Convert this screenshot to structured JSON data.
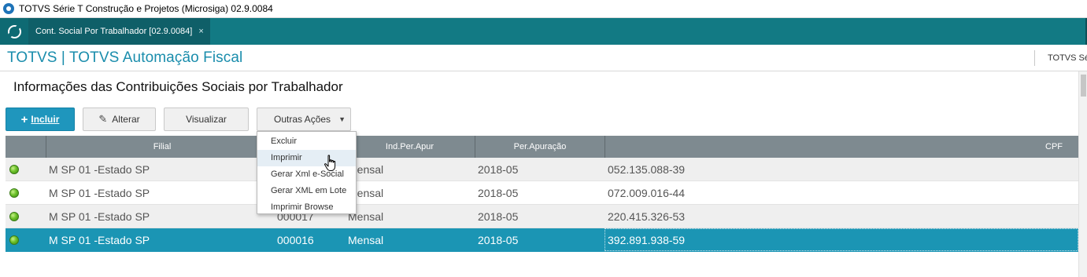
{
  "window": {
    "title": "TOTVS Série T Construção e Projetos (Microsiga) 02.9.0084"
  },
  "tabs": [
    {
      "label": "Cont. Social Por Trabalhador [02.9.0084]",
      "close": "×"
    }
  ],
  "module": {
    "name": "TOTVS | TOTVS Automação Fiscal",
    "right_info": "TOTVS Sé"
  },
  "page": {
    "title": "Informações das Contribuições Sociais por Trabalhador"
  },
  "toolbar": {
    "incluir": {
      "label": "Incluir",
      "icon": "plus-icon"
    },
    "alterar": {
      "label": "Alterar",
      "icon": "pencil-icon"
    },
    "visualizar": {
      "label": "Visualizar"
    },
    "outras": {
      "label": "Outras Ações",
      "icon": "caret-down-icon"
    }
  },
  "menu": {
    "items": [
      "Excluir",
      "Imprimir",
      "Gerar Xml e-Social",
      "Gerar XML em Lote",
      "Imprimir Browse"
    ],
    "hovered_index": 1
  },
  "grid": {
    "columns": [
      "",
      "Filial",
      "",
      "Ind.Per.Apur",
      "Per.Apuração",
      "CPF"
    ],
    "rows": [
      {
        "status": "green",
        "filial": "M SP 01 -Estado SP",
        "id": "",
        "ind": "Mensal",
        "per": "2018-05",
        "cpf": "052.135.088-39"
      },
      {
        "status": "green",
        "filial": "M SP 01 -Estado SP",
        "id": "",
        "ind": "Mensal",
        "per": "2018-05",
        "cpf": "072.009.016-44"
      },
      {
        "status": "green",
        "filial": "M SP 01 -Estado SP",
        "id": "000017",
        "ind": "Mensal",
        "per": "2018-05",
        "cpf": "220.415.326-53"
      },
      {
        "status": "green",
        "filial": "M SP 01 -Estado SP",
        "id": "000016",
        "ind": "Mensal",
        "per": "2018-05",
        "cpf": "392.891.938-59"
      }
    ],
    "selected_index": 3
  },
  "colors": {
    "tabbar": "#127a84",
    "module_title": "#1a8dac",
    "primary_button": "#1f96bd",
    "grid_header": "#7e8a90",
    "selected_row": "#1b95b4",
    "status_green": "#6dc12a"
  }
}
